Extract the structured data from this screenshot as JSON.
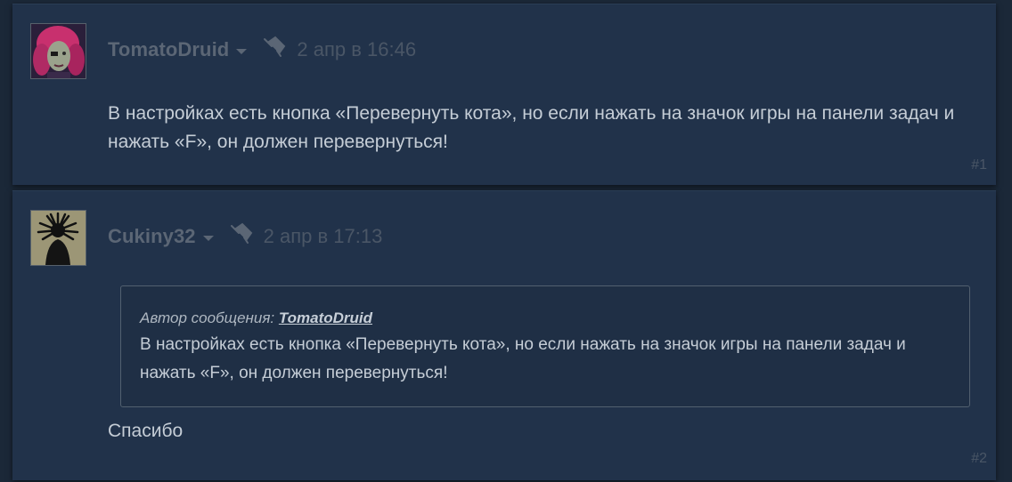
{
  "posts": [
    {
      "author": "TomatoDruid",
      "timestamp": "2 апр в 16:46",
      "text": "В настройках есть кнопка «Перевернуть кота», но если нажать на значок игры на панели задач и нажать «F», он должен перевернуться!",
      "number": "#1",
      "avatar": "pink-haired-character-avatar"
    },
    {
      "author": "Cukiny32",
      "timestamp": "2 апр в 17:13",
      "quote": {
        "author_prefix": "Автор сообщения: ",
        "author": "TomatoDruid",
        "text": "В настройках есть кнопка «Перевернуть кота», но если нажать на значок игры на панели задач и нажать «F», он должен перевернуться!"
      },
      "text": "Спасибо",
      "number": "#2",
      "avatar": "spiky-silhouette-avatar"
    }
  ],
  "colors": {
    "page_bg": "#1b2838",
    "post_bg": "#21324a",
    "author": "#5b6675",
    "timestamp": "#4a5666",
    "text": "#c5cdd6",
    "quote_border": "#52606f"
  }
}
